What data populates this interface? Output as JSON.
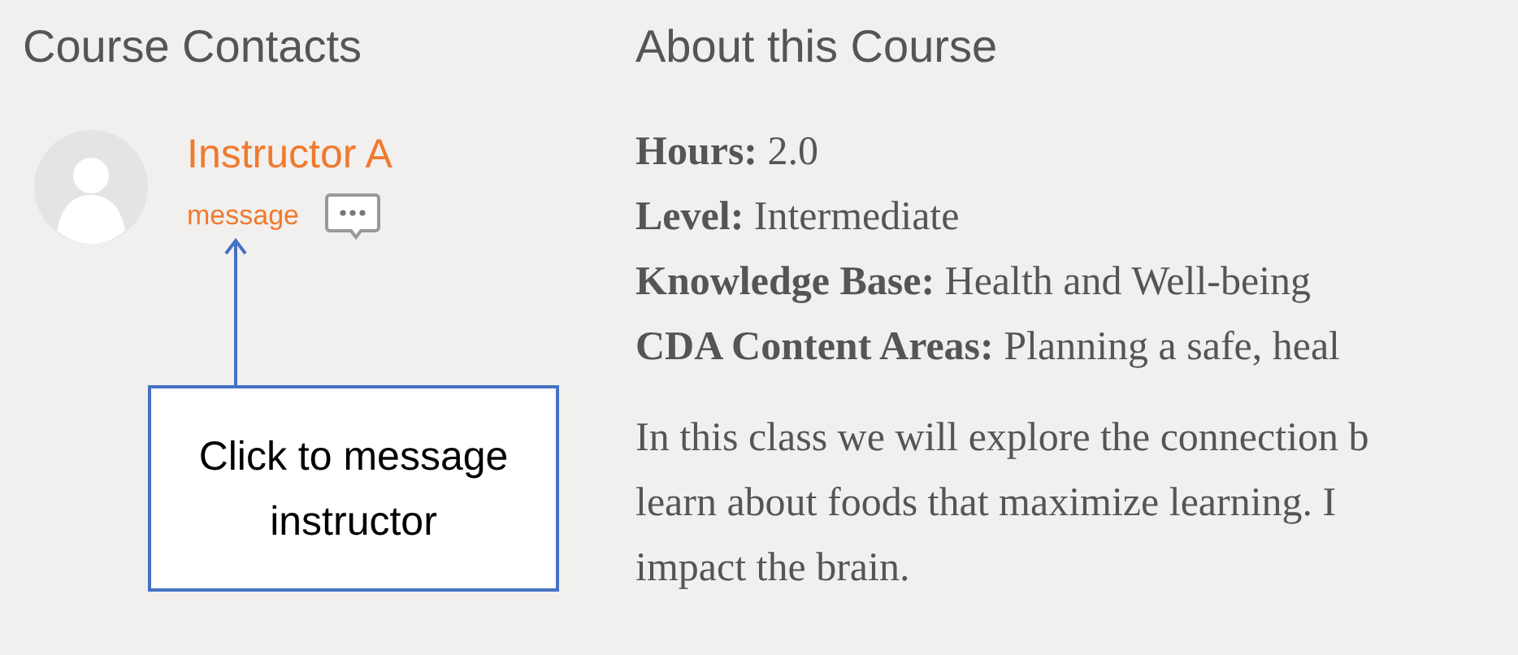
{
  "contacts": {
    "heading": "Course Contacts",
    "instructor": {
      "name": "Instructor A",
      "message_link": "message"
    }
  },
  "about": {
    "heading": "About this Course",
    "details": [
      {
        "label": "Hours:",
        "value": "2.0"
      },
      {
        "label": "Level:",
        "value": "Intermediate"
      },
      {
        "label": "Knowledge Base:",
        "value": "Health and Well-being"
      },
      {
        "label": "CDA Content Areas:",
        "value": "Planning a safe, heal"
      }
    ],
    "description": [
      "In this class we will explore the connection b",
      "learn about foods that maximize learning. I",
      "impact the brain."
    ]
  },
  "callout": {
    "text": "Click to message instructor"
  }
}
